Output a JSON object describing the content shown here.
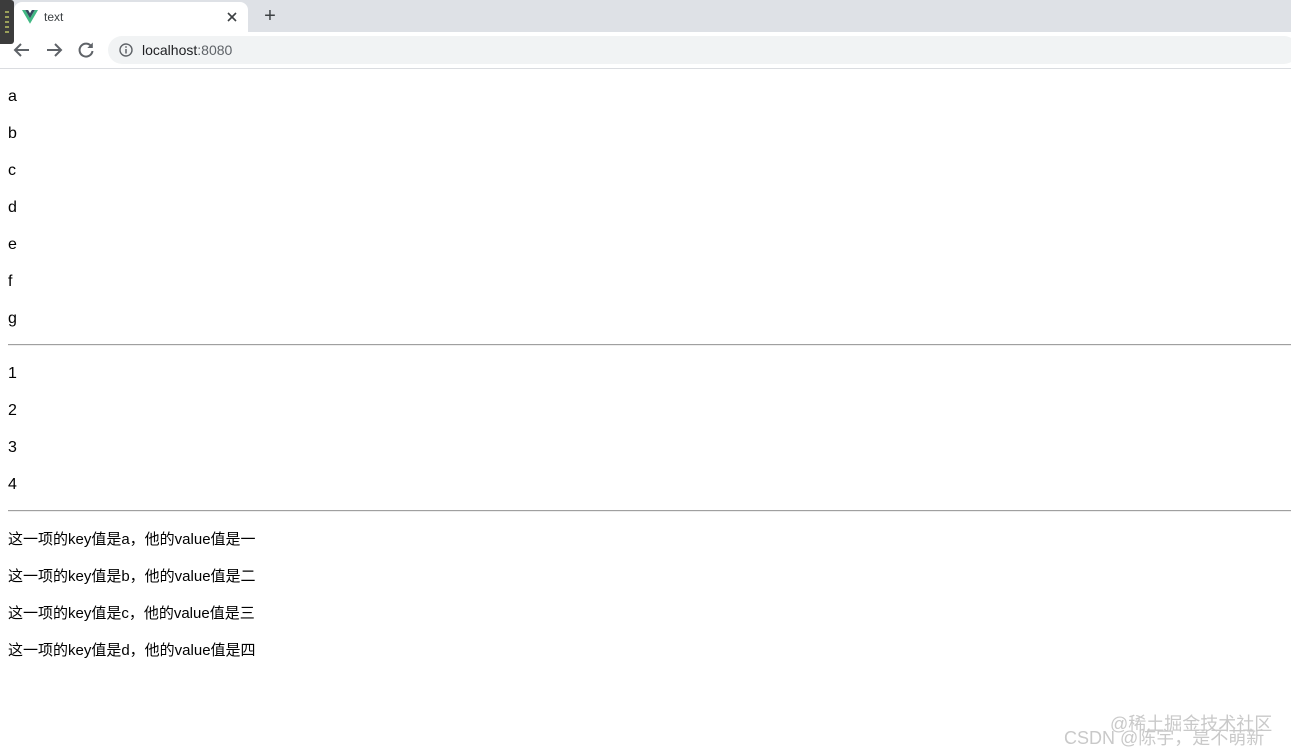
{
  "browser": {
    "tab_title": "text",
    "new_tab_symbol": "+",
    "close_symbol": "✕",
    "url_host": "localhost",
    "url_port": ":8080",
    "favicon": "vue-logo-icon",
    "colors": {
      "favicon_green": "#41b883",
      "favicon_dark": "#35495e",
      "tabstrip": "#dee1e6",
      "omnibox": "#f1f3f4"
    }
  },
  "page": {
    "letters": [
      "a",
      "b",
      "c",
      "d",
      "e",
      "f",
      "g"
    ],
    "numbers": [
      "1",
      "2",
      "3",
      "4"
    ],
    "pairs": [
      "这一项的key值是a，他的value值是一",
      "这一项的key值是b，他的value值是二",
      "这一项的key值是c，他的value值是三",
      "这一项的key值是d，他的value值是四"
    ]
  },
  "watermark": {
    "line1": "@稀土掘金技术社区",
    "line2": "CSDN @陈宇，是不萌新"
  }
}
